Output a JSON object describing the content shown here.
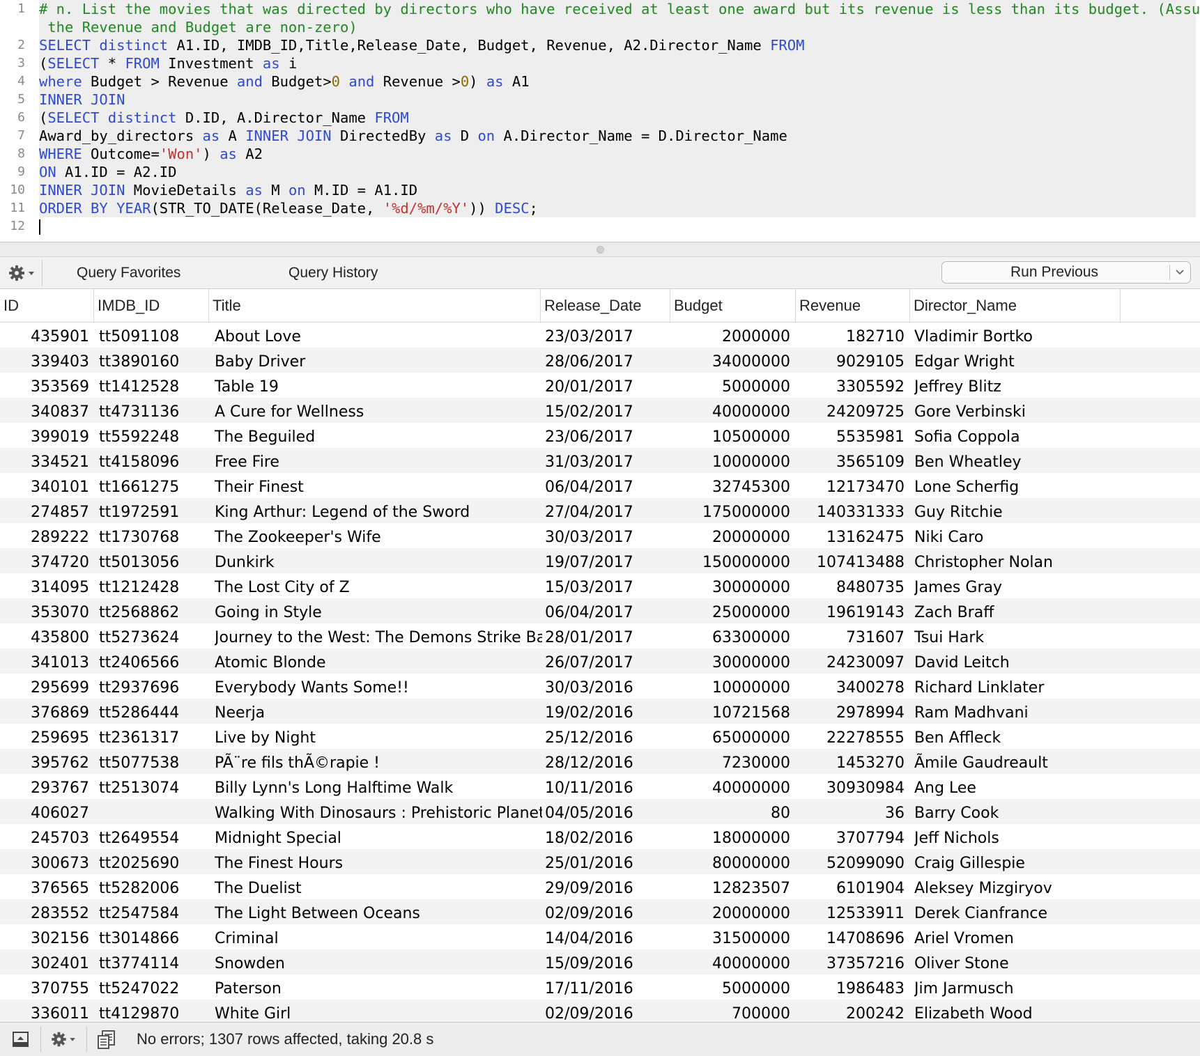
{
  "editor": {
    "line_numbers": [
      "1",
      "",
      "2",
      "3",
      "4",
      "5",
      "6",
      "7",
      "8",
      "9",
      "10",
      "11",
      "12"
    ],
    "lines": [
      [
        {
          "t": "# n. List the movies that was directed by directors who have received at least one award but its revenue is less than its budget. (Assume",
          "c": "cm"
        }
      ],
      [
        {
          "t": " the Revenue and Budget are non-zero)",
          "c": "cm"
        }
      ],
      [
        {
          "t": "SELECT distinct ",
          "c": "kw"
        },
        {
          "t": "A1.ID, IMDB_ID,Title,Release_Date, Budget, Revenue, A2.Director_Name ",
          "c": ""
        },
        {
          "t": "FROM",
          "c": "kw"
        }
      ],
      [
        {
          "t": "(",
          "c": ""
        },
        {
          "t": "SELECT",
          "c": "kw"
        },
        {
          "t": " * ",
          "c": ""
        },
        {
          "t": "FROM",
          "c": "kw"
        },
        {
          "t": " Investment ",
          "c": ""
        },
        {
          "t": "as",
          "c": "kw"
        },
        {
          "t": " i",
          "c": ""
        }
      ],
      [
        {
          "t": "where",
          "c": "kw"
        },
        {
          "t": " Budget > Revenue ",
          "c": ""
        },
        {
          "t": "and",
          "c": "kw"
        },
        {
          "t": " Budget>",
          "c": ""
        },
        {
          "t": "0",
          "c": "nm"
        },
        {
          "t": " ",
          "c": ""
        },
        {
          "t": "and",
          "c": "kw"
        },
        {
          "t": " Revenue >",
          "c": ""
        },
        {
          "t": "0",
          "c": "nm"
        },
        {
          "t": ") ",
          "c": ""
        },
        {
          "t": "as",
          "c": "kw"
        },
        {
          "t": " A1",
          "c": ""
        }
      ],
      [
        {
          "t": "INNER JOIN",
          "c": "kw"
        }
      ],
      [
        {
          "t": "(",
          "c": ""
        },
        {
          "t": "SELECT distinct",
          "c": "kw"
        },
        {
          "t": " D.ID, A.Director_Name ",
          "c": ""
        },
        {
          "t": "FROM",
          "c": "kw"
        }
      ],
      [
        {
          "t": "Award_by_directors ",
          "c": ""
        },
        {
          "t": "as",
          "c": "kw"
        },
        {
          "t": " A ",
          "c": ""
        },
        {
          "t": "INNER JOIN",
          "c": "kw"
        },
        {
          "t": " DirectedBy ",
          "c": ""
        },
        {
          "t": "as",
          "c": "kw"
        },
        {
          "t": " D ",
          "c": ""
        },
        {
          "t": "on",
          "c": "kw"
        },
        {
          "t": " A.Director_Name = D.Director_Name",
          "c": ""
        }
      ],
      [
        {
          "t": "WHERE",
          "c": "kw"
        },
        {
          "t": " Outcome=",
          "c": ""
        },
        {
          "t": "'Won'",
          "c": "st"
        },
        {
          "t": ") ",
          "c": ""
        },
        {
          "t": "as",
          "c": "kw"
        },
        {
          "t": " A2",
          "c": ""
        }
      ],
      [
        {
          "t": "ON",
          "c": "kw"
        },
        {
          "t": " A1.ID = A2.ID",
          "c": ""
        }
      ],
      [
        {
          "t": "INNER JOIN",
          "c": "kw"
        },
        {
          "t": " MovieDetails ",
          "c": ""
        },
        {
          "t": "as",
          "c": "kw"
        },
        {
          "t": " M ",
          "c": ""
        },
        {
          "t": "on",
          "c": "kw"
        },
        {
          "t": " M.ID = A1.ID",
          "c": ""
        }
      ],
      [
        {
          "t": "ORDER BY YEAR",
          "c": "kw"
        },
        {
          "t": "(STR_TO_DATE(Release_Date, ",
          "c": ""
        },
        {
          "t": "'%d/%m/%Y'",
          "c": "st"
        },
        {
          "t": ")) ",
          "c": ""
        },
        {
          "t": "DESC",
          "c": "kw"
        },
        {
          "t": ";",
          "c": ""
        }
      ],
      []
    ]
  },
  "toolbar": {
    "gear_icon": "gear-icon",
    "query_favorites_label": "Query Favorites",
    "query_history_label": "Query History",
    "run_previous_label": "Run Previous"
  },
  "table": {
    "columns": [
      "ID",
      "IMDB_ID",
      "Title",
      "Release_Date",
      "Budget",
      "Revenue",
      "Director_Name"
    ],
    "rows": [
      [
        "435901",
        "tt5091108",
        "About Love",
        "23/03/2017",
        "2000000",
        "182710",
        "Vladimir Bortko"
      ],
      [
        "339403",
        "tt3890160",
        "Baby Driver",
        "28/06/2017",
        "34000000",
        "9029105",
        "Edgar Wright"
      ],
      [
        "353569",
        "tt1412528",
        "Table 19",
        "20/01/2017",
        "5000000",
        "3305592",
        "Jeffrey Blitz"
      ],
      [
        "340837",
        "tt4731136",
        "A Cure for Wellness",
        "15/02/2017",
        "40000000",
        "24209725",
        "Gore Verbinski"
      ],
      [
        "399019",
        "tt5592248",
        "The Beguiled",
        "23/06/2017",
        "10500000",
        "5535981",
        "Sofia Coppola"
      ],
      [
        "334521",
        "tt4158096",
        "Free Fire",
        "31/03/2017",
        "10000000",
        "3565109",
        "Ben Wheatley"
      ],
      [
        "340101",
        "tt1661275",
        "Their Finest",
        "06/04/2017",
        "32745300",
        "12173470",
        "Lone Scherfig"
      ],
      [
        "274857",
        "tt1972591",
        "King Arthur: Legend of the Sword",
        "27/04/2017",
        "175000000",
        "140331333",
        "Guy Ritchie"
      ],
      [
        "289222",
        "tt1730768",
        "The Zookeeper's Wife",
        "30/03/2017",
        "20000000",
        "13162475",
        "Niki Caro"
      ],
      [
        "374720",
        "tt5013056",
        "Dunkirk",
        "19/07/2017",
        "150000000",
        "107413488",
        "Christopher Nolan"
      ],
      [
        "314095",
        "tt1212428",
        "The Lost City of Z",
        "15/03/2017",
        "30000000",
        "8480735",
        "James Gray"
      ],
      [
        "353070",
        "tt2568862",
        "Going in Style",
        "06/04/2017",
        "25000000",
        "19619143",
        "Zach Braff"
      ],
      [
        "435800",
        "tt5273624",
        "Journey to the West: The Demons Strike Back",
        "28/01/2017",
        "63300000",
        "731607",
        "Tsui Hark"
      ],
      [
        "341013",
        "tt2406566",
        "Atomic Blonde",
        "26/07/2017",
        "30000000",
        "24230097",
        "David Leitch"
      ],
      [
        "295699",
        "tt2937696",
        "Everybody Wants Some!!",
        "30/03/2016",
        "10000000",
        "3400278",
        "Richard Linklater"
      ],
      [
        "376869",
        "tt5286444",
        "Neerja",
        "19/02/2016",
        "10721568",
        "2978994",
        "Ram Madhvani"
      ],
      [
        "259695",
        "tt2361317",
        "Live by Night",
        "25/12/2016",
        "65000000",
        "22278555",
        "Ben Affleck"
      ],
      [
        "395762",
        "tt5077538",
        "PÃ¨re fils thÃ©rapie !",
        "28/12/2016",
        "7230000",
        "1453270",
        "Ãmile Gaudreault"
      ],
      [
        "293767",
        "tt2513074",
        "Billy Lynn's Long Halftime Walk",
        "10/11/2016",
        "40000000",
        "30930984",
        "Ang Lee"
      ],
      [
        "406027",
        "",
        "Walking With Dinosaurs : Prehistoric Planet",
        "04/05/2016",
        "80",
        "36",
        "Barry Cook"
      ],
      [
        "245703",
        "tt2649554",
        "Midnight Special",
        "18/02/2016",
        "18000000",
        "3707794",
        "Jeff Nichols"
      ],
      [
        "300673",
        "tt2025690",
        "The Finest Hours",
        "25/01/2016",
        "80000000",
        "52099090",
        "Craig Gillespie"
      ],
      [
        "376565",
        "tt5282006",
        "The Duelist",
        "29/09/2016",
        "12823507",
        "6101904",
        "Aleksey Mizgiryov"
      ],
      [
        "283552",
        "tt2547584",
        "The Light Between Oceans",
        "02/09/2016",
        "20000000",
        "12533911",
        "Derek Cianfrance"
      ],
      [
        "302156",
        "tt3014866",
        "Criminal",
        "14/04/2016",
        "31500000",
        "14708696",
        "Ariel Vromen"
      ],
      [
        "302401",
        "tt3774114",
        "Snowden",
        "15/09/2016",
        "40000000",
        "37357216",
        "Oliver Stone"
      ],
      [
        "370755",
        "tt5247022",
        "Paterson",
        "17/11/2016",
        "5000000",
        "1986483",
        "Jim Jarmusch"
      ],
      [
        "336011",
        "tt4129870",
        "White Girl",
        "02/09/2016",
        "700000",
        "200242",
        "Elizabeth Wood"
      ]
    ]
  },
  "status": {
    "message": "No errors; 1307 rows affected, taking 20.8 s"
  }
}
